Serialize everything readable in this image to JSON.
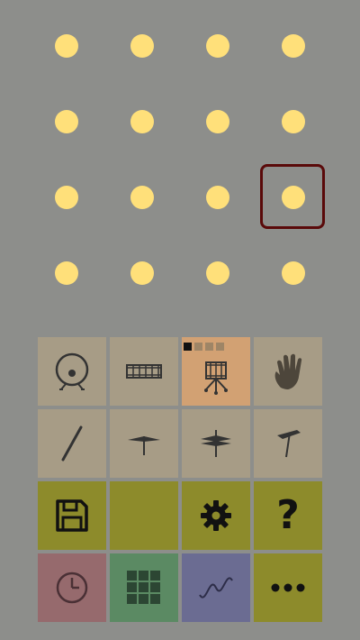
{
  "sequencer": {
    "rows": 4,
    "columns": 4,
    "selected_step": {
      "row": 3,
      "column": 4
    },
    "step_color": "#ffe07a",
    "selection_color": "#5a0a0a"
  },
  "pads": [
    {
      "name": "kick-drum-pad",
      "icon": "bass-drum-icon",
      "group": "instrument"
    },
    {
      "name": "snare-drum-pad",
      "icon": "snare-drum-icon",
      "group": "instrument"
    },
    {
      "name": "drum-kit-pad",
      "icon": "drum-kit-icon",
      "group": "instrument",
      "active": true,
      "kit_count": 4,
      "kit_selected": 1
    },
    {
      "name": "hand-clap-pad",
      "icon": "hand-icon",
      "group": "instrument"
    },
    {
      "name": "stick-pad",
      "icon": "drumstick-icon",
      "group": "instrument"
    },
    {
      "name": "hi-hat-pad",
      "icon": "hi-hat-icon",
      "group": "instrument"
    },
    {
      "name": "cymbal-pad",
      "icon": "cymbal-icon",
      "group": "instrument"
    },
    {
      "name": "crash-cymbal-pad",
      "icon": "crash-cymbal-icon",
      "group": "instrument"
    },
    {
      "name": "save-button",
      "icon": "floppy-disk-icon",
      "group": "control"
    },
    {
      "name": "blank-button",
      "icon": "",
      "group": "control"
    },
    {
      "name": "settings-button",
      "icon": "gear-icon",
      "group": "control"
    },
    {
      "name": "help-button",
      "icon": "question-mark-icon",
      "group": "control",
      "label": "?"
    },
    {
      "name": "tempo-button",
      "icon": "clock-icon",
      "group": "control"
    },
    {
      "name": "pattern-grid-button",
      "icon": "grid-icon",
      "group": "control"
    },
    {
      "name": "swing-button",
      "icon": "sine-wave-icon",
      "group": "control"
    },
    {
      "name": "more-button",
      "icon": "more-dots-icon",
      "group": "control"
    }
  ],
  "colors": {
    "background": "#8d8e8b",
    "instrument_pad": "#a79c86",
    "instrument_pad_active": "#d2a173",
    "olive": "#8d8b2b",
    "pink": "#966a6d",
    "green": "#5b8a63",
    "purple": "#6b6c92"
  }
}
